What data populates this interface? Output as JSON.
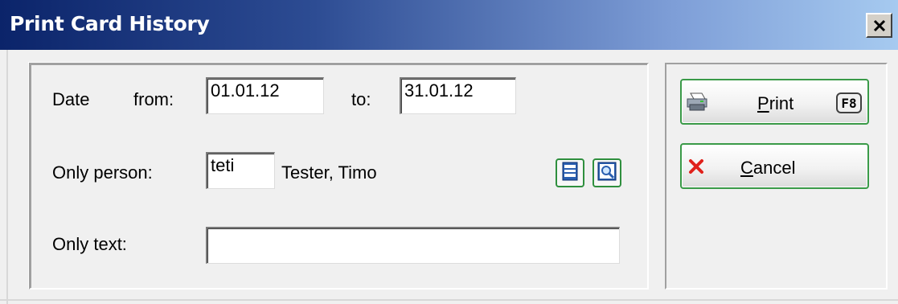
{
  "window": {
    "title": "Print Card History",
    "close_label": "x"
  },
  "filters": {
    "date_label": "Date",
    "from_label": "from:",
    "from_value": "01.01.12",
    "to_label": "to:",
    "to_value": "31.01.12",
    "person_label": "Only person:",
    "person_code": "teti",
    "person_name": "Tester, Timo",
    "text_label": "Only text:",
    "text_value": ""
  },
  "actions": {
    "print_mnemonic": "P",
    "print_rest": "rint",
    "print_shortcut": "F8",
    "cancel_mnemonic": "C",
    "cancel_rest": "ancel"
  },
  "icons": {
    "print": "printer-icon",
    "cancel": "red-x-icon",
    "select_person": "list-select-icon",
    "search_person": "magnifier-icon",
    "close": "close-icon"
  },
  "colors": {
    "title_start": "#0b246a",
    "title_end": "#a6caf0",
    "button_border": "#3a9a48",
    "cancel_x": "#e0211b"
  }
}
